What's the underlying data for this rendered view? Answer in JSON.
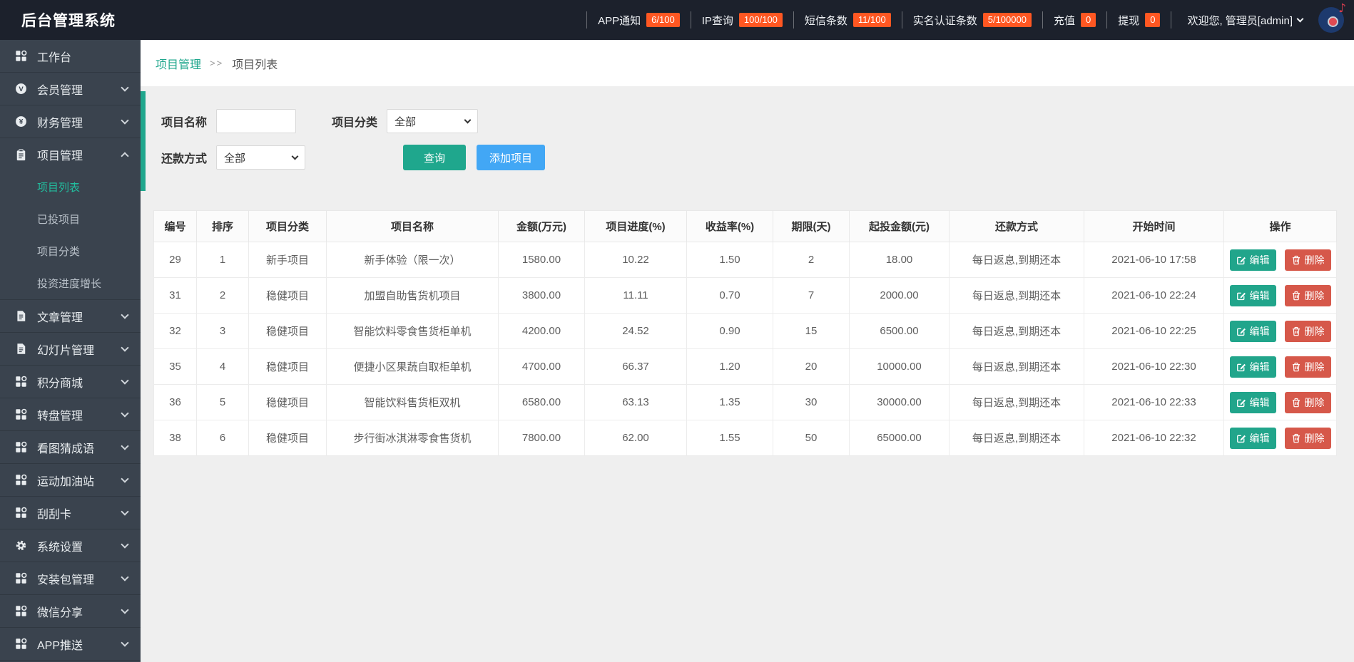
{
  "topbar": {
    "brand": "后台管理系统",
    "stats": [
      {
        "label": "APP通知",
        "value": "6/100"
      },
      {
        "label": "IP查询",
        "value": "100/100"
      },
      {
        "label": "短信条数",
        "value": "11/100"
      },
      {
        "label": "实名认证条数",
        "value": "5/100000"
      },
      {
        "label": "充值",
        "value": "0"
      },
      {
        "label": "提现",
        "value": "0"
      }
    ],
    "welcome": "欢迎您, 管理员[admin]"
  },
  "sidebar": {
    "items": [
      {
        "label": "工作台",
        "icon": "grid-icon"
      },
      {
        "label": "会员管理",
        "icon": "member-icon",
        "chevron": "down"
      },
      {
        "label": "财务管理",
        "icon": "finance-icon",
        "chevron": "down"
      },
      {
        "label": "项目管理",
        "icon": "clipboard-icon",
        "chevron": "up",
        "children": [
          {
            "label": "项目列表",
            "active": true
          },
          {
            "label": "已投项目"
          },
          {
            "label": "项目分类"
          },
          {
            "label": "投资进度增长"
          }
        ]
      },
      {
        "label": "文章管理",
        "icon": "doc-icon",
        "chevron": "down"
      },
      {
        "label": "幻灯片管理",
        "icon": "doc-icon",
        "chevron": "down"
      },
      {
        "label": "积分商城",
        "icon": "grid-icon",
        "chevron": "down"
      },
      {
        "label": "转盘管理",
        "icon": "grid-icon",
        "chevron": "down"
      },
      {
        "label": "看图猜成语",
        "icon": "grid-icon",
        "chevron": "down"
      },
      {
        "label": "运动加油站",
        "icon": "grid-icon",
        "chevron": "down"
      },
      {
        "label": "刮刮卡",
        "icon": "grid-icon",
        "chevron": "down"
      },
      {
        "label": "系统设置",
        "icon": "gear-icon",
        "chevron": "down"
      },
      {
        "label": "安装包管理",
        "icon": "grid-icon",
        "chevron": "down"
      },
      {
        "label": "微信分享",
        "icon": "grid-icon",
        "chevron": "down"
      },
      {
        "label": "APP推送",
        "icon": "grid-icon",
        "chevron": "down"
      }
    ]
  },
  "breadcrumb": {
    "section": "项目管理",
    "separator": ">>",
    "current": "项目列表"
  },
  "filters": {
    "name_label": "项目名称",
    "name_value": "",
    "category_label": "项目分类",
    "category_value": "全部",
    "repay_label": "还款方式",
    "repay_value": "全部",
    "search_button": "查询",
    "add_button": "添加项目"
  },
  "table": {
    "headers": [
      "编号",
      "排序",
      "项目分类",
      "项目名称",
      "金额(万元)",
      "项目进度(%)",
      "收益率(%)",
      "期限(天)",
      "起投金额(元)",
      "还款方式",
      "开始时间",
      "操作"
    ],
    "edit_label": "编辑",
    "delete_label": "删除",
    "rows": [
      [
        "29",
        "1",
        "新手项目",
        "新手体验（限一次）",
        "1580.00",
        "10.22",
        "1.50",
        "2",
        "18.00",
        "每日返息,到期还本",
        "2021-06-10 17:58"
      ],
      [
        "31",
        "2",
        "稳健项目",
        "加盟自助售货机项目",
        "3800.00",
        "11.11",
        "0.70",
        "7",
        "2000.00",
        "每日返息,到期还本",
        "2021-06-10 22:24"
      ],
      [
        "32",
        "3",
        "稳健项目",
        "智能饮料零食售货柜单机",
        "4200.00",
        "24.52",
        "0.90",
        "15",
        "6500.00",
        "每日返息,到期还本",
        "2021-06-10 22:25"
      ],
      [
        "35",
        "4",
        "稳健项目",
        "便捷小区果蔬自取柜单机",
        "4700.00",
        "66.37",
        "1.20",
        "20",
        "10000.00",
        "每日返息,到期还本",
        "2021-06-10 22:30"
      ],
      [
        "36",
        "5",
        "稳健项目",
        "智能饮料售货柜双机",
        "6580.00",
        "63.13",
        "1.35",
        "30",
        "30000.00",
        "每日返息,到期还本",
        "2021-06-10 22:33"
      ],
      [
        "38",
        "6",
        "稳健项目",
        "步行街冰淇淋零食售货机",
        "7800.00",
        "62.00",
        "1.55",
        "50",
        "65000.00",
        "每日返息,到期还本",
        "2021-06-10 22:32"
      ]
    ]
  },
  "colors": {
    "accent": "#1fa78d",
    "add_button_blue": "#42a7f5",
    "delete_red": "#d6584a",
    "badge_orange": "#ff5722",
    "topbar_bg": "#1c212c",
    "sidebar_bg": "#3a434e"
  }
}
